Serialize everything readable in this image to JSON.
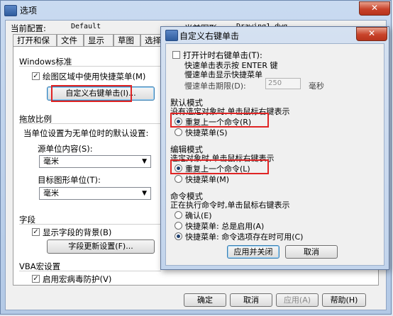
{
  "options_window": {
    "title": "选项",
    "close_glyph": "✕",
    "current_profile_label": "当前配置:",
    "current_profile_value": "Default",
    "current_drawing_label": "当前图形:",
    "current_drawing_value": "Drawing1.dwg",
    "tabs": [
      "打开和保存",
      "文件",
      "显示",
      "草图",
      "选择"
    ],
    "windows_std": {
      "title": "Windows标准",
      "shortcut_menu_label": "绘图区域中使用快捷菜单(M)",
      "shortcut_menu_checked": true,
      "custom_right_click_button": "自定义右键单击(I)..."
    },
    "drag_scale": {
      "title": "拖放比例",
      "desc": "当单位设置为无单位时的默认设置:",
      "source_label": "源单位内容(S):",
      "source_value": "毫米",
      "target_label": "目标图形单位(T):",
      "target_value": "毫米"
    },
    "field": {
      "title": "字段",
      "show_bg_label": "显示字段的背景(B)",
      "show_bg_checked": true,
      "update_button": "字段更新设置(F)..."
    },
    "vba": {
      "title": "VBA宏设置",
      "virus_label": "启用宏病毒防护(V)",
      "virus_checked": true
    },
    "footer": {
      "ok": "确定",
      "cancel": "取消",
      "apply": "应用(A)",
      "help": "帮助(H)"
    }
  },
  "right_click_dialog": {
    "title": "自定义右键单击",
    "close_glyph": "✕",
    "timed": {
      "label": "打开计时右键单击(T):",
      "checked": false,
      "line1": "快速单击表示按 ENTER 键",
      "line2": "慢速单击显示快捷菜单",
      "duration_label": "慢速单击期限(D):",
      "duration_value": "250",
      "duration_unit": "毫秒"
    },
    "default_mode": {
      "title": "默认模式",
      "desc": "没有选定对象时,单击鼠标右键表示",
      "opt1": "重复上一个命令(R)",
      "opt2": "快捷菜单(S)",
      "selected": "opt1"
    },
    "edit_mode": {
      "title": "编辑模式",
      "desc": "选定对象时,单击鼠标右键表示",
      "opt1": "重复上一个命令(L)",
      "opt2": "快捷菜单(M)",
      "selected": "opt1"
    },
    "command_mode": {
      "title": "命令模式",
      "desc": "正在执行命令时,单击鼠标右键表示",
      "opt1": "确认(E)",
      "opt2": "快捷菜单: 总是启用(A)",
      "opt3": "快捷菜单: 命令选项存在时可用(C)",
      "selected": "opt3"
    },
    "apply_close_button": "应用并关闭",
    "cancel_button": "取消"
  },
  "colors": {
    "highlight_red": "#e02424",
    "title_bar": "#c9daf0",
    "close_red": "#c8432a"
  }
}
